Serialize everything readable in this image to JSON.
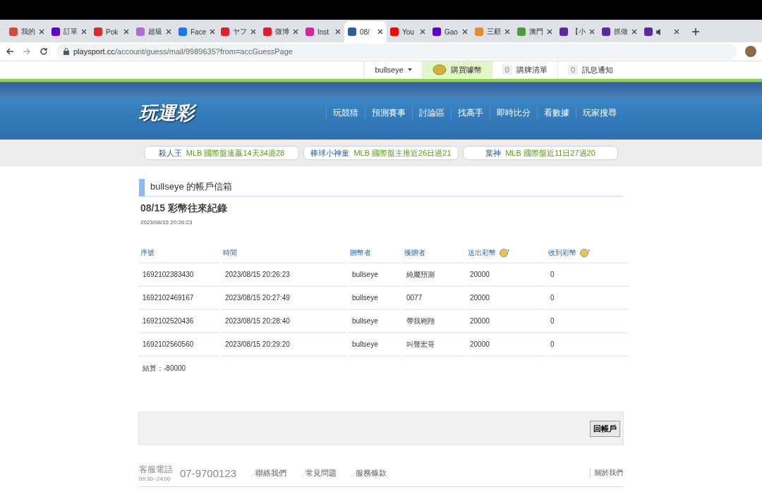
{
  "browser": {
    "tabs": [
      {
        "title": "我的",
        "selected": false,
        "color": "#d9473b"
      },
      {
        "title": "訂單",
        "selected": false,
        "color": "#5f01d1"
      },
      {
        "title": "Pok",
        "selected": false,
        "color": "#d42b2b"
      },
      {
        "title": "超級",
        "selected": false,
        "color": "#b36ad8"
      },
      {
        "title": "Face",
        "selected": false,
        "color": "#1877f2"
      },
      {
        "title": "ヤフ",
        "selected": false,
        "color": "#e0202a"
      },
      {
        "title": "微博",
        "selected": false,
        "color": "#e6162d"
      },
      {
        "title": "Inst",
        "selected": false,
        "color": "#d6249f"
      },
      {
        "title": "08/",
        "selected": true,
        "color": "#2a5d9a"
      },
      {
        "title": "You",
        "selected": false,
        "color": "#ff0000"
      },
      {
        "title": "Gao",
        "selected": false,
        "color": "#6001d2"
      },
      {
        "title": "三顧",
        "selected": false,
        "color": "#e8892b"
      },
      {
        "title": "澳門",
        "selected": false,
        "color": "#4a9b3a"
      },
      {
        "title": "【小",
        "selected": false,
        "color": "#5b2aa0"
      },
      {
        "title": "抓做",
        "selected": false,
        "color": "#5b2aa0"
      },
      {
        "selected": false,
        "color": "#5b2aa0"
      }
    ],
    "url_host": "playsport.cc",
    "url_path": "/account/guess/mail/9989635?from=accGuessPage"
  },
  "userbar": {
    "user": "bullseye",
    "buy": "購買噱幣",
    "items": [
      {
        "count": "0",
        "label": "購牌清單"
      },
      {
        "count": "0",
        "label": "訊息通知"
      }
    ]
  },
  "header": {
    "logo": "玩運彩",
    "nav": [
      "玩競猜",
      "預測賽事",
      "討論區",
      "找高手",
      "即時比分",
      "看數據",
      "玩家搜尋"
    ]
  },
  "ranks": [
    {
      "name": "殺人王",
      "text": "MLB  國際盤連贏14天34過28"
    },
    {
      "name": "棒球小神童",
      "text": "MLB  國際盤主推近26日過21"
    },
    {
      "name": "葉神",
      "text": "MLB  國際盤近11日27過20"
    }
  ],
  "section_title": "bullseye 的帳戶信箱",
  "mail": {
    "title": "08/15 彩幣往來紀錄",
    "date": "2023/08/15 20:26:23"
  },
  "table": {
    "columns": [
      {
        "label": "序號",
        "coin": false
      },
      {
        "label": "時間",
        "coin": false
      },
      {
        "label": "贈幣者",
        "coin": false
      },
      {
        "label": "獲贈者",
        "coin": false
      },
      {
        "label": "送出彩幣",
        "coin": true
      },
      {
        "label": "收到彩幣",
        "coin": true
      }
    ],
    "rows": [
      [
        "1692102383430",
        "2023/08/15 20:26:23",
        "bullseye",
        "純屬預測",
        "20000",
        "0"
      ],
      [
        "1692102469167",
        "2023/08/15 20:27:49",
        "bullseye",
        "0077",
        "20000",
        "0"
      ],
      [
        "1692102520436",
        "2023/08/15 20:28:40",
        "bullseye",
        "帶我翱翔",
        "20000",
        "0"
      ],
      [
        "1692102560560",
        "2023/08/15 20:29:20",
        "bullseye",
        "叫聲宏哥",
        "20000",
        "0"
      ]
    ]
  },
  "total": "結算：-80000",
  "back_button": "回帳戶",
  "footer": {
    "label": "客服電話",
    "hours": "09:30~24:00",
    "phone": "07-9700123",
    "links": [
      "聯絡我們",
      "常見問題",
      "服務條款"
    ],
    "about": "關於我們"
  }
}
